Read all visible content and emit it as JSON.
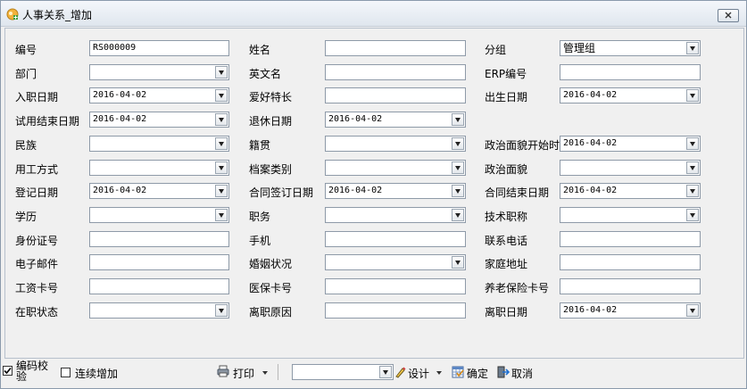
{
  "window": {
    "title": "人事关系_增加"
  },
  "form": {
    "col1": [
      {
        "label": "编号",
        "value": "RS000009",
        "dropdown": false
      },
      {
        "label": "部门",
        "value": "",
        "dropdown": true
      },
      {
        "label": "入职日期",
        "value": "2016-04-02",
        "dropdown": true
      },
      {
        "label": "试用结束日期",
        "value": "2016-04-02",
        "dropdown": true
      },
      {
        "label": "民族",
        "value": "",
        "dropdown": true
      },
      {
        "label": "用工方式",
        "value": "",
        "dropdown": true
      },
      {
        "label": "登记日期",
        "value": "2016-04-02",
        "dropdown": true
      },
      {
        "label": "学历",
        "value": "",
        "dropdown": true
      },
      {
        "label": "身份证号",
        "value": "",
        "dropdown": false
      },
      {
        "label": "电子邮件",
        "value": "",
        "dropdown": false
      },
      {
        "label": "工资卡号",
        "value": "",
        "dropdown": false
      },
      {
        "label": "在职状态",
        "value": "",
        "dropdown": true
      }
    ],
    "col2": [
      {
        "label": "姓名",
        "value": "",
        "dropdown": false
      },
      {
        "label": "英文名",
        "value": "",
        "dropdown": false
      },
      {
        "label": "爱好特长",
        "value": "",
        "dropdown": false
      },
      {
        "label": "退休日期",
        "value": "2016-04-02",
        "dropdown": true
      },
      {
        "label": "籍贯",
        "value": "",
        "dropdown": true
      },
      {
        "label": "档案类别",
        "value": "",
        "dropdown": true
      },
      {
        "label": "合同签订日期",
        "value": "2016-04-02",
        "dropdown": true
      },
      {
        "label": "职务",
        "value": "",
        "dropdown": true
      },
      {
        "label": "手机",
        "value": "",
        "dropdown": false
      },
      {
        "label": "婚姻状况",
        "value": "",
        "dropdown": true
      },
      {
        "label": "医保卡号",
        "value": "",
        "dropdown": false
      },
      {
        "label": "离职原因",
        "value": "",
        "dropdown": false
      }
    ],
    "col3": [
      {
        "label": "分组",
        "value": "管理组",
        "dropdown": true
      },
      {
        "label": "ERP编号",
        "value": "",
        "dropdown": false
      },
      {
        "label": "出生日期",
        "value": "2016-04-02",
        "dropdown": true
      },
      null,
      {
        "label": "政治面貌开始时",
        "value": "2016-04-02",
        "dropdown": true
      },
      {
        "label": "政治面貌",
        "value": "",
        "dropdown": true
      },
      {
        "label": "合同结束日期",
        "value": "2016-04-02",
        "dropdown": true
      },
      {
        "label": "技术职称",
        "value": "",
        "dropdown": true
      },
      {
        "label": "联系电话",
        "value": "",
        "dropdown": false
      },
      {
        "label": "家庭地址",
        "value": "",
        "dropdown": false
      },
      {
        "label": "养老保险卡号",
        "value": "",
        "dropdown": false
      },
      {
        "label": "离职日期",
        "value": "2016-04-02",
        "dropdown": true
      }
    ]
  },
  "bottom": {
    "code_check_label": "编码校验",
    "code_check_checked": true,
    "continuous_add_label": "连续增加",
    "continuous_add_checked": false,
    "print_label": "打印",
    "template_select_value": "",
    "design_label": "设计",
    "confirm_label": "确定",
    "cancel_label": "取消"
  }
}
